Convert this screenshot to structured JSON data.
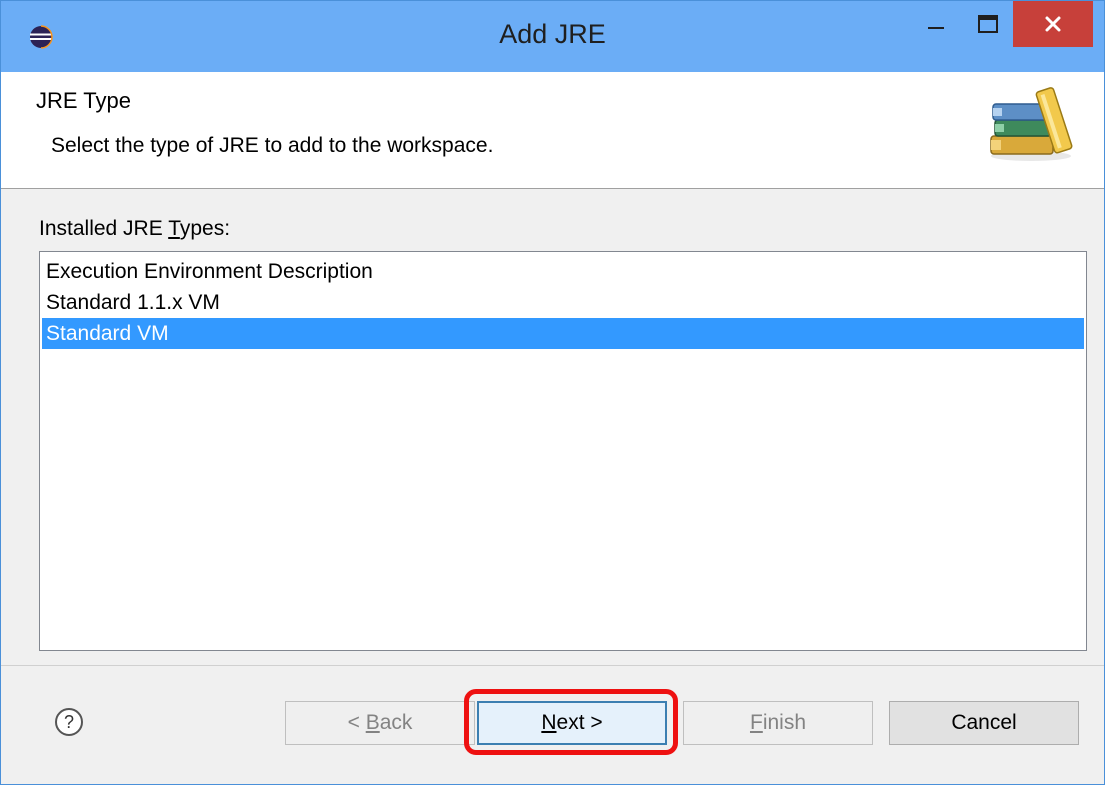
{
  "window": {
    "title": "Add JRE",
    "accent_color": "#6badf6",
    "close_color": "#c7403a"
  },
  "header": {
    "title": "JRE Type",
    "description": "Select the type of JRE to add to the workspace.",
    "icon": "books-icon"
  },
  "list": {
    "label_prefix": "Installed JRE ",
    "label_mnemonic": "T",
    "label_suffix": "ypes:",
    "items": [
      {
        "label": "Execution Environment Description",
        "selected": false
      },
      {
        "label": "Standard 1.1.x VM",
        "selected": false
      },
      {
        "label": "Standard VM",
        "selected": true
      }
    ],
    "selection_color": "#3399ff"
  },
  "buttons": {
    "back_prefix": "< ",
    "back_mnemonic": "B",
    "back_suffix": "ack",
    "next_mnemonic": "N",
    "next_suffix": "ext >",
    "finish_mnemonic": "F",
    "finish_suffix": "inish",
    "cancel": "Cancel"
  },
  "annotation": {
    "highlight_color": "#ee1111"
  }
}
